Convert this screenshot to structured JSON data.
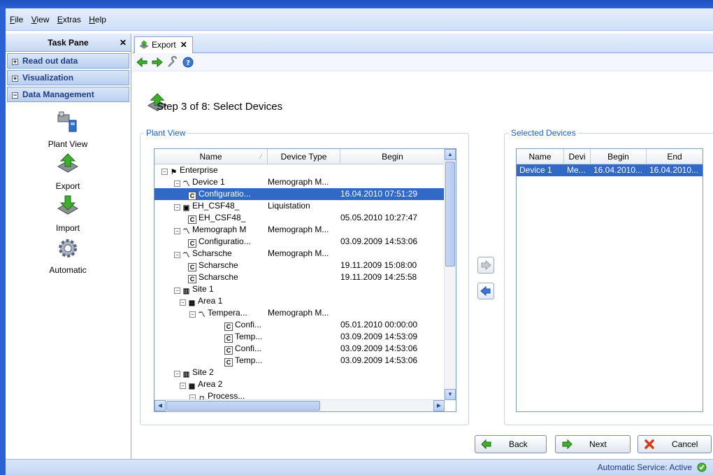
{
  "menu": {
    "file": "File",
    "view": "View",
    "extras": "Extras",
    "help": "Help"
  },
  "task_pane": {
    "title": "Task Pane",
    "sections": {
      "read_out": "Read out data",
      "visualization": "Visualization",
      "data_management": "Data Management"
    },
    "items": {
      "plant_view": "Plant View",
      "export": "Export",
      "import": "Import",
      "automatic": "Automatic"
    }
  },
  "tab": {
    "label": "Export"
  },
  "step": {
    "title": "Step 3 of 8: Select Devices"
  },
  "plant_view": {
    "label": "Plant View",
    "columns": {
      "name": "Name",
      "device_type": "Device Type",
      "begin": "Begin"
    },
    "rows": [
      {
        "name": "Enterprise",
        "type": "",
        "begin": ""
      },
      {
        "name": "Device 1",
        "type": "Memograph  M...",
        "begin": ""
      },
      {
        "name": "Configuratio...",
        "type": "",
        "begin": "16.04.2010 07:51:29"
      },
      {
        "name": "EH_CSF48_",
        "type": "Liquistation",
        "begin": ""
      },
      {
        "name": "EH_CSF48_",
        "type": "",
        "begin": "05.05.2010 10:27:47"
      },
      {
        "name": "Memograph M",
        "type": "Memograph  M...",
        "begin": ""
      },
      {
        "name": "Configuratio...",
        "type": "",
        "begin": "03.09.2009 14:53:06"
      },
      {
        "name": "Scharsche",
        "type": "Memograph  M...",
        "begin": ""
      },
      {
        "name": "Scharsche",
        "type": "",
        "begin": "19.11.2009 15:08:00"
      },
      {
        "name": "Scharsche",
        "type": "",
        "begin": "19.11.2009 14:25:58"
      },
      {
        "name": "Site 1",
        "type": "",
        "begin": ""
      },
      {
        "name": "Area 1",
        "type": "",
        "begin": ""
      },
      {
        "name": "Tempera...",
        "type": "Memograph  M...",
        "begin": ""
      },
      {
        "name": "Confi...",
        "type": "",
        "begin": "05.01.2010 00:00:00"
      },
      {
        "name": "Temp...",
        "type": "",
        "begin": "03.09.2009 14:53:09"
      },
      {
        "name": "Confi...",
        "type": "",
        "begin": "03.09.2009 14:53:06"
      },
      {
        "name": "Temp...",
        "type": "",
        "begin": "03.09.2009 14:53:06"
      },
      {
        "name": "Site 2",
        "type": "",
        "begin": ""
      },
      {
        "name": "Area 2",
        "type": "",
        "begin": ""
      },
      {
        "name": "Process...",
        "type": "",
        "begin": ""
      }
    ]
  },
  "selected_devices": {
    "label": "Selected Devices",
    "columns": {
      "name": "Name",
      "devi": "Devi",
      "begin": "Begin",
      "end": "End"
    },
    "row": {
      "name": "Device 1",
      "devi": "Me...",
      "begin": "16.04.2010...",
      "end": "16.04.2010..."
    }
  },
  "buttons": {
    "back": "Back",
    "next": "Next",
    "cancel": "Cancel"
  },
  "status": {
    "text": "Automatic Service: Active"
  },
  "colors": {
    "selection": "#3169c6",
    "accent": "#1f5fbf"
  }
}
